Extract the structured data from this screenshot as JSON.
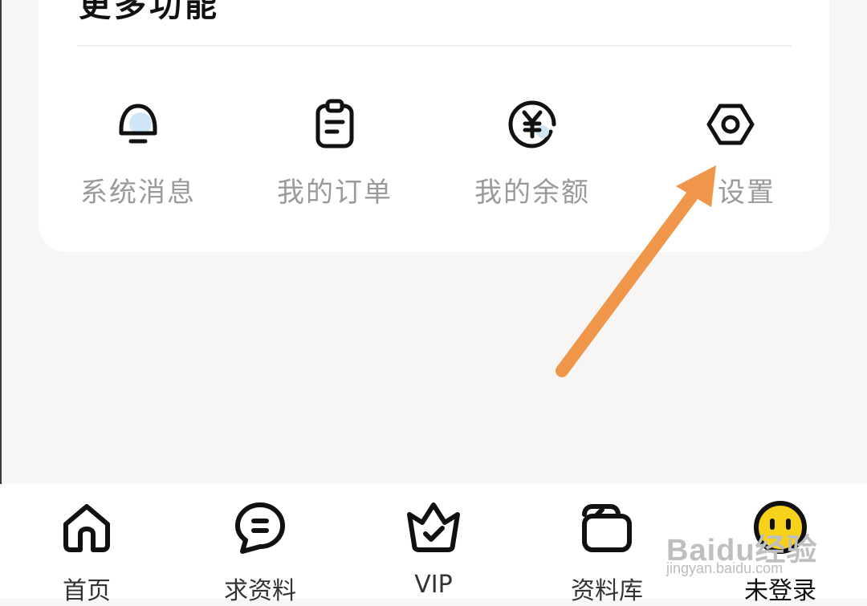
{
  "section": {
    "title": "更多功能"
  },
  "functions": [
    {
      "label": "系统消息",
      "icon": "bell-icon"
    },
    {
      "label": "我的订单",
      "icon": "clipboard-icon"
    },
    {
      "label": "我的余额",
      "icon": "yen-wallet-icon"
    },
    {
      "label": "设置",
      "icon": "gear-icon"
    }
  ],
  "tabbar": {
    "items": [
      {
        "label": "首页",
        "icon": "home-icon"
      },
      {
        "label": "求资料",
        "icon": "chat-icon"
      },
      {
        "label": "VIP",
        "icon": "crown-icon"
      },
      {
        "label": "资料库",
        "icon": "folder-icon"
      },
      {
        "label": "未登录",
        "icon": "avatar-icon"
      }
    ],
    "active_index": 4
  },
  "watermark": {
    "text": "Baidu经验",
    "sub": "jingyan.baidu.com"
  },
  "colors": {
    "accent_blue": "#cfe6f7",
    "arrow_orange": "#f0964a",
    "avatar_yellow": "#f7d21a"
  }
}
